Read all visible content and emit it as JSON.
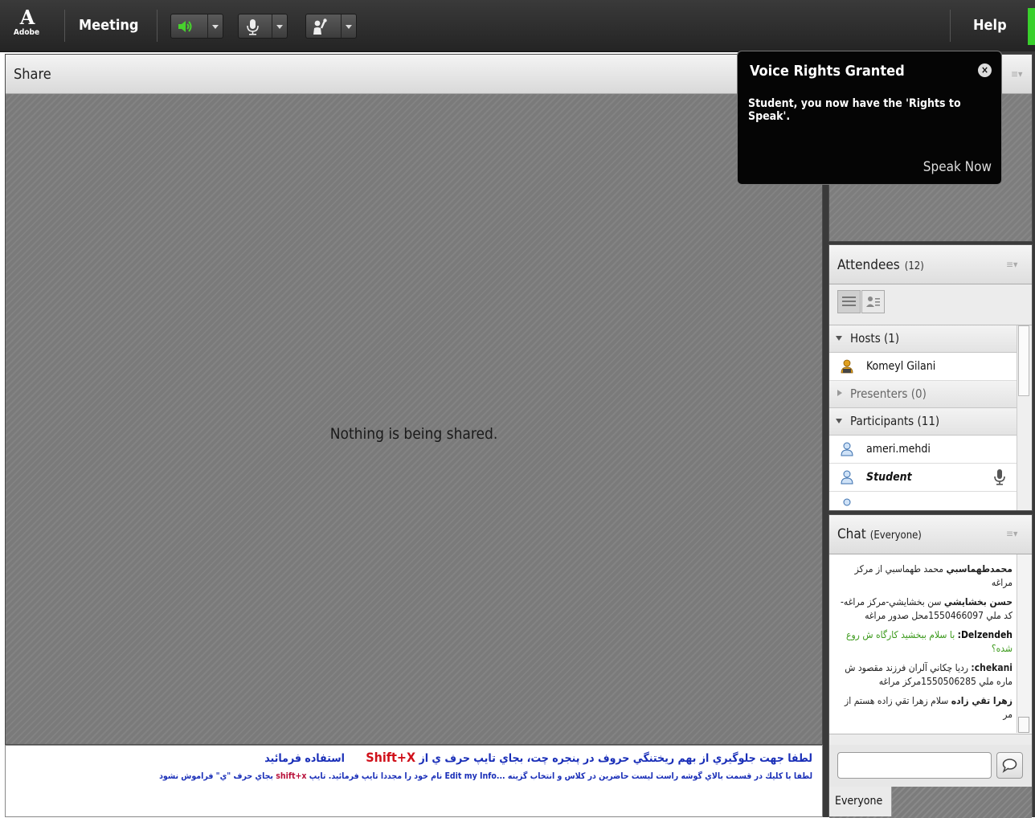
{
  "menubar": {
    "logo_mark": "A",
    "logo_text": "Adobe",
    "meeting_label": "Meeting",
    "speaker_icon": "speaker-icon",
    "mic_icon": "microphone-icon",
    "raise_hand_icon": "raise-hand-icon",
    "help_label": "Help",
    "speaker_color": "#47d12d"
  },
  "share_pod": {
    "title": "Share",
    "empty_message": "Nothing is being shared."
  },
  "notification": {
    "title": "Voice Rights Granted",
    "message": "Student, you now have the 'Rights to Speak'.",
    "action_label": "Speak Now"
  },
  "attendees": {
    "title": "Attendees",
    "count": "(12)",
    "hosts_label": "Hosts (1)",
    "hosts": [
      "Komeyl Gilani"
    ],
    "presenters_label": "Presenters (0)",
    "participants_label": "Participants (11)",
    "participants": [
      "ameri.mehdi",
      "Student"
    ]
  },
  "chat": {
    "title": "Chat",
    "scope": "(Everyone)",
    "messages": [
      {
        "name": "محمدطهماسبي",
        "text": "محمد طهماسبي از مركز مراغه"
      },
      {
        "name": "حسن بخشايشي",
        "text": "سن بخشايشي-مركز مراغه- كد ملي 1550466097محل صدور مراغه"
      },
      {
        "name": "Delzendeh:",
        "text": "با سلام ببخشيد كارگاه ش روع شده؟"
      },
      {
        "name": "chekani:",
        "text": "رديا چكاني آلران فرزند مقصود ش ماره ملي 1550506285مركز مراغه"
      },
      {
        "name": "زهرا تقي زاده",
        "text": "سلام زهرا تقي زاده هستم از مر"
      }
    ],
    "input_value": "",
    "send_icon": "speech-bubble-icon",
    "tab_label": "Everyone"
  },
  "notes": {
    "line1_main": "لطفا جهت جلوگيري از بهم ريختنگي حروف در پنجره چت، بجاي تايپ حرف   ي   از",
    "line1_key": "Shift+X",
    "line1_end": "استفاده فرمائيد",
    "line2_main": "لطفا با كليك در قسمت بالاي گوشه راست ليست حاضرين در كلاس و انتخاب گزينه ...Edit my Info نام خود را مجددا تايپ فرمائيد. تايپ",
    "line2_key": "shift+x",
    "line2_end": "بجاي حرف \"ي\" فراموش نشود",
    "text_color": "#1a2fb8",
    "accent_color": "#d0101a"
  }
}
